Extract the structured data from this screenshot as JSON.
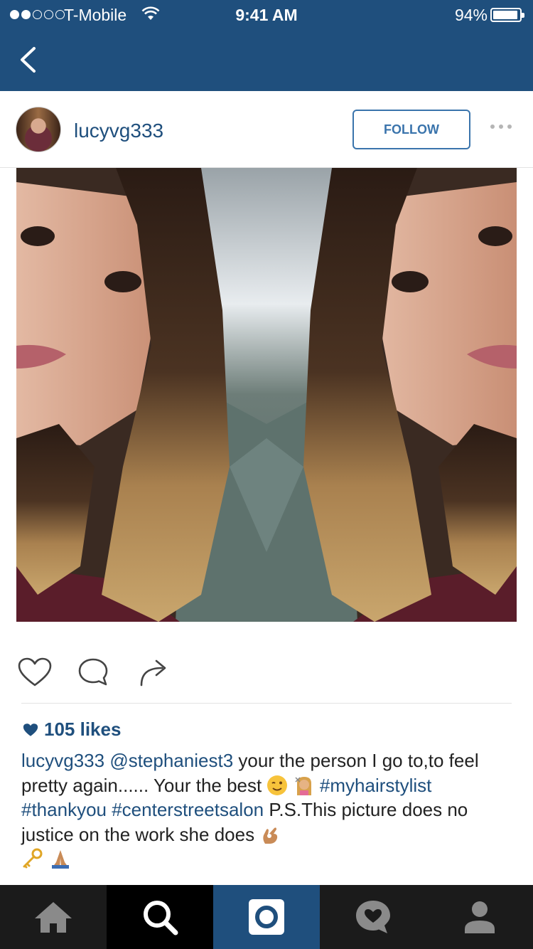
{
  "status_bar": {
    "carrier": "T-Mobile",
    "time": "9:41 AM",
    "battery": "94%",
    "battery_level": 0.94,
    "signal_bars_filled": 2,
    "signal_bars_total": 5
  },
  "colors": {
    "header_bg": "#1f4f7d",
    "link": "#1f4f7d",
    "follow_border": "#3a74ac"
  },
  "post": {
    "username": "lucyvg333",
    "follow_label": "FOLLOW",
    "likes": "105 likes",
    "caption": {
      "user": "lucyvg333",
      "mention": "@stephaniest3",
      "text1": " your the person I go to,to feel pretty again...... Your the best ",
      "tag1": "#myhairstylist",
      "tag2": "#thankyou",
      "tag3": "#centerstreetsalon",
      "text2": " P.S.This picture does no justice on the work she does "
    }
  },
  "icons": [
    "back-chevron-icon",
    "more-dots-icon",
    "heart-icon",
    "comment-icon",
    "share-icon",
    "home-icon",
    "search-icon",
    "camera-icon",
    "activity-icon",
    "profile-icon"
  ],
  "tabs": [
    "home",
    "search",
    "camera",
    "activity",
    "profile"
  ]
}
